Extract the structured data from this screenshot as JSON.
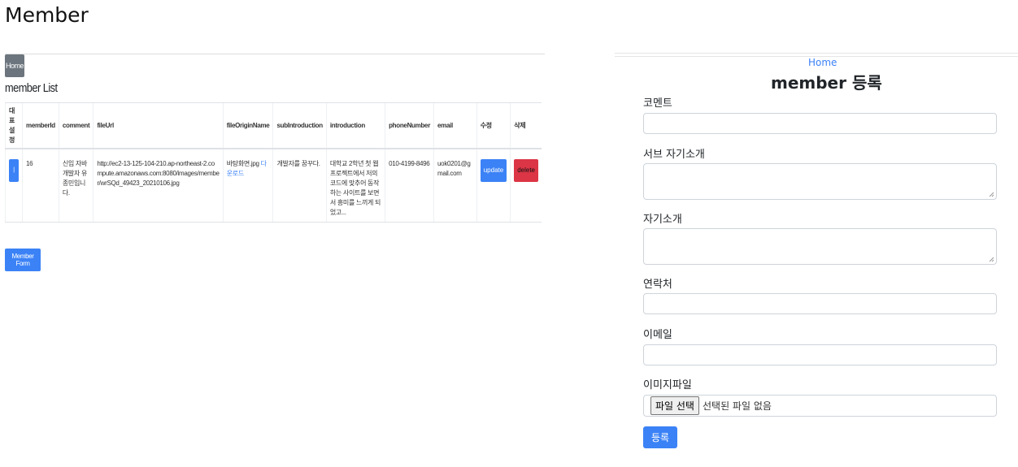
{
  "page_title": "Member",
  "left": {
    "home_button": "Home",
    "list_title": "member List",
    "table": {
      "headers": [
        "대표설정",
        "memberId",
        "comment",
        "fileUrl",
        "fileOriginName",
        "subIntroduction",
        "introduction",
        "phoneNumber",
        "email",
        "수정",
        "삭제"
      ],
      "rows": [
        {
          "radio": "|",
          "memberId": "16",
          "comment": "신입 자바 개발자 유종민입니다.",
          "fileUrl": "http://ec2-13-125-104-210.ap-northeast-2.compute.amazonaws.com:8080/images/member/wrSQd_49423_20210106.jpg",
          "fileOriginName": "바탕화면.jpg",
          "download": "다운로드",
          "subIntroduction": "개발자를 꿈꾸다.",
          "introduction": "대학교 2학년 첫 웹 프로젝트에서 저의 코드에 맞추어 동작하는 사이트를 보면서 흥미를 느끼게 되었고...",
          "phoneNumber": "010-4199-8496",
          "email": "uok0201@gmail.com",
          "update": "update",
          "delete": "delete"
        }
      ]
    },
    "member_form_button": "Member Form"
  },
  "right": {
    "home_link": "Home",
    "form_title": "member 등록",
    "fields": {
      "comment_label": "코멘트",
      "sub_intro_label": "서브 자기소개",
      "intro_label": "자기소개",
      "phone_label": "연락처",
      "email_label": "이메일",
      "image_label": "이미지파일"
    },
    "file_input": {
      "button": "파일 선택",
      "status": "선택된 파일 없음"
    },
    "submit_button": "등록"
  },
  "colors": {
    "primary": "#3b82f6",
    "danger": "#dc3545",
    "secondary": "#6c757d"
  }
}
